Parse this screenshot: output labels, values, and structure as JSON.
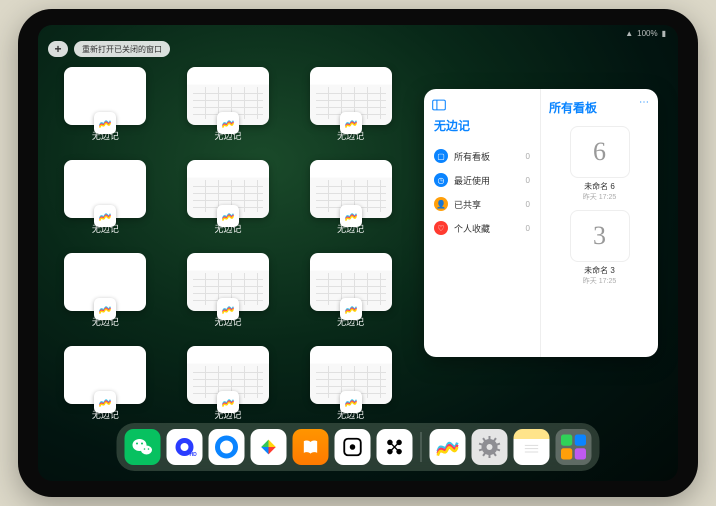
{
  "status": {
    "wifi": "􀙇",
    "battery": "100%"
  },
  "top_controls": {
    "plus": "+",
    "reopen": "重新打开已关闭的窗口"
  },
  "windows": [
    {
      "label": "无边记",
      "style": "blank"
    },
    {
      "label": "无边记",
      "style": "content"
    },
    {
      "label": "无边记",
      "style": "content"
    },
    {
      "label": "无边记",
      "style": "blank"
    },
    {
      "label": "无边记",
      "style": "content"
    },
    {
      "label": "无边记",
      "style": "content"
    },
    {
      "label": "无边记",
      "style": "blank"
    },
    {
      "label": "无边记",
      "style": "content"
    },
    {
      "label": "无边记",
      "style": "content"
    },
    {
      "label": "无边记",
      "style": "blank"
    },
    {
      "label": "无边记",
      "style": "content"
    },
    {
      "label": "无边记",
      "style": "content"
    }
  ],
  "panel": {
    "title": "无边记",
    "menu": [
      {
        "label": "所有看板",
        "count": "0",
        "color": "#0a84ff",
        "glyph": "▢"
      },
      {
        "label": "最近使用",
        "count": "0",
        "color": "#0a84ff",
        "glyph": "◷"
      },
      {
        "label": "已共享",
        "count": "0",
        "color": "#ff9f0a",
        "glyph": "👤"
      },
      {
        "label": "个人收藏",
        "count": "0",
        "color": "#ff3b30",
        "glyph": "♡"
      }
    ],
    "right_title": "所有看板",
    "more": "⋯",
    "boards": [
      {
        "name": "未命名 6",
        "date": "昨天 17:25",
        "preview": "6"
      },
      {
        "name": "未命名 3",
        "date": "昨天 17:25",
        "preview": "3"
      }
    ]
  },
  "dock": {
    "apps": [
      {
        "name": "wechat",
        "bg": "#07c160",
        "glyph": "wechat"
      },
      {
        "name": "quark",
        "bg": "#ffffff",
        "glyph": "quark"
      },
      {
        "name": "browser",
        "bg": "#ffffff",
        "glyph": "qblue"
      },
      {
        "name": "play",
        "bg": "#ffffff",
        "glyph": "play"
      },
      {
        "name": "books",
        "bg": "linear-gradient(#ff9500,#ff7a00)",
        "glyph": "books"
      },
      {
        "name": "dice",
        "bg": "#ffffff",
        "glyph": "dice"
      },
      {
        "name": "connect",
        "bg": "#ffffff",
        "glyph": "connect"
      }
    ],
    "recents": [
      {
        "name": "freeform",
        "bg": "#ffffff",
        "glyph": "freeform"
      },
      {
        "name": "settings",
        "bg": "#e5e5e5",
        "glyph": "gear"
      },
      {
        "name": "notes",
        "bg": "linear-gradient(#ffe48a 0 28%,#fff 28%)",
        "glyph": "note"
      },
      {
        "name": "app-library",
        "bg": "rgba(255,255,255,0.25)",
        "glyph": "library"
      }
    ]
  }
}
